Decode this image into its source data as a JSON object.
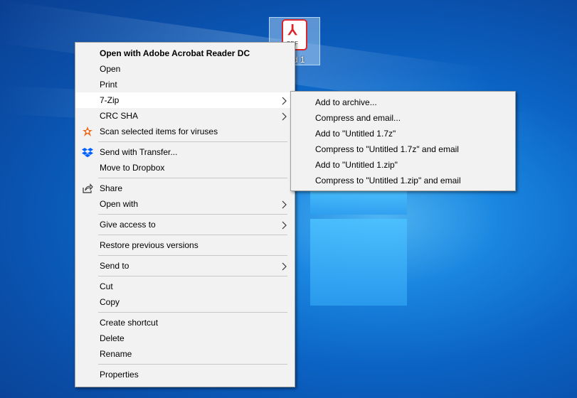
{
  "desktop_icon": {
    "label": "Untitled 1",
    "visible_label": "tled 1",
    "glyph_text": "PDF"
  },
  "context_menu": {
    "groups": [
      [
        {
          "label": "Open with Adobe Acrobat Reader DC",
          "bold": true
        },
        {
          "label": "Open"
        },
        {
          "label": "Print"
        },
        {
          "label": "7-Zip",
          "submenu": true,
          "hover": true
        },
        {
          "label": "CRC SHA",
          "submenu": true
        },
        {
          "label": "Scan selected items for viruses",
          "icon": "avast-icon"
        }
      ],
      [
        {
          "label": "Send with Transfer...",
          "icon": "dropbox-icon"
        },
        {
          "label": "Move to Dropbox"
        }
      ],
      [
        {
          "label": "Share",
          "icon": "share-icon"
        },
        {
          "label": "Open with",
          "submenu": true
        }
      ],
      [
        {
          "label": "Give access to",
          "submenu": true
        }
      ],
      [
        {
          "label": "Restore previous versions"
        }
      ],
      [
        {
          "label": "Send to",
          "submenu": true
        }
      ],
      [
        {
          "label": "Cut"
        },
        {
          "label": "Copy"
        }
      ],
      [
        {
          "label": "Create shortcut"
        },
        {
          "label": "Delete"
        },
        {
          "label": "Rename"
        }
      ],
      [
        {
          "label": "Properties"
        }
      ]
    ]
  },
  "zip_submenu": {
    "items": [
      "Add to archive...",
      "Compress and email...",
      "Add to \"Untitled 1.7z\"",
      "Compress to \"Untitled 1.7z\" and email",
      "Add to \"Untitled 1.zip\"",
      "Compress to \"Untitled 1.zip\" and email"
    ]
  },
  "colors": {
    "menu_bg": "#f2f2f2",
    "hover_bg": "#ffffff",
    "avast": "#f26a1b",
    "dropbox": "#0061fe",
    "pdf_red": "#d9242b"
  }
}
